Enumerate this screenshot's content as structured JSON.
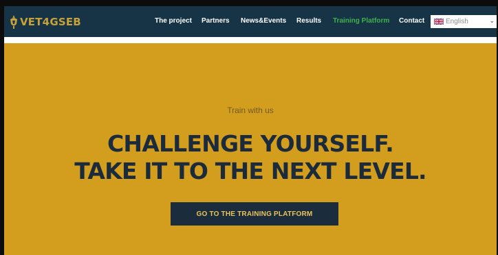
{
  "brand": {
    "logo_text": "VET4GSEB"
  },
  "nav": {
    "items": [
      {
        "label": "The project"
      },
      {
        "label": "Partners"
      },
      {
        "label": "News&Events"
      },
      {
        "label": "Results"
      },
      {
        "label": "Training Platform",
        "active": true
      },
      {
        "label": "Contact"
      }
    ],
    "active_color": "#3fb24a"
  },
  "language": {
    "selected": "English",
    "flag_icon": "uk-flag-icon"
  },
  "hero": {
    "eyebrow": "Train with us",
    "headline_line1": "CHALLENGE YOURSELF.",
    "headline_line2": "TAKE IT TO THE NEXT LEVEL.",
    "cta_label": "GO TO THE TRAINING PLATFORM",
    "background_color": "#d39e1d",
    "headline_color": "#1c2b3c"
  },
  "colors": {
    "navbar_bg": "#163446",
    "brand_gold": "#c7a23a"
  }
}
